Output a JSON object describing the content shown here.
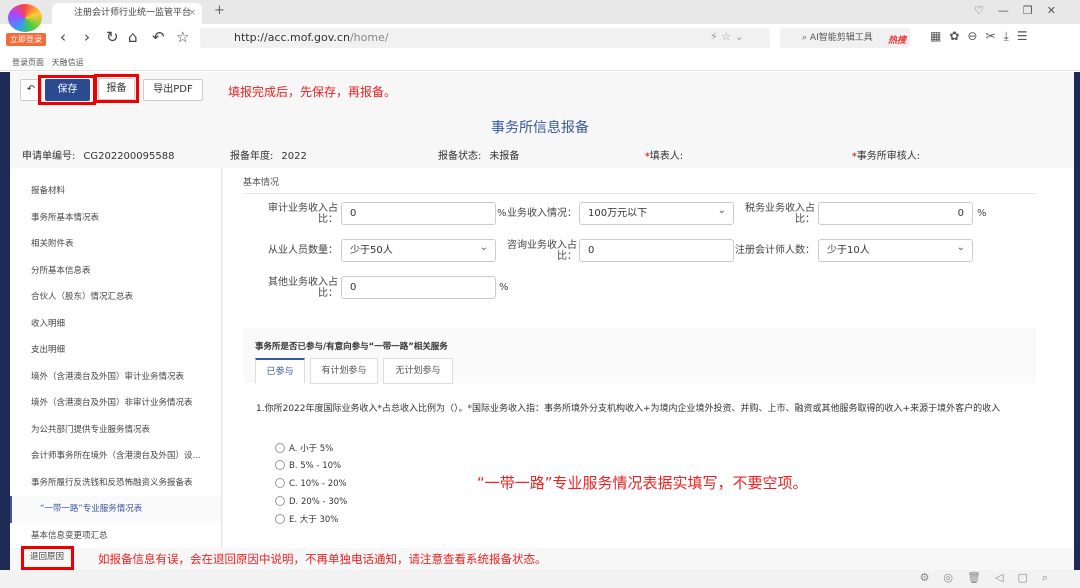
{
  "browser": {
    "tab_title": "注册会计师行业统一监管平台",
    "login_badge": "立即登录",
    "url_domain": "http://acc.mof.gov.cn",
    "url_path": "/home/",
    "search_placeholder": "AI智能剪辑工具",
    "hot_label": "热搜",
    "bookmarks": [
      "登录页面",
      "天融信运"
    ]
  },
  "toolbar": {
    "save": "保存",
    "file": "报备",
    "export": "导出PDF",
    "note": "填报完成后，先保存，再报备。"
  },
  "page": {
    "title": "事务所信息报备",
    "info": [
      {
        "label": "申请单编号:",
        "value": "CG202200095588"
      },
      {
        "label": "报备年度:",
        "value": "2022"
      },
      {
        "label": "报备状态:",
        "value": "未报备"
      },
      {
        "label": "填表人:",
        "value": ""
      },
      {
        "label": "事务所审核人:",
        "value": ""
      }
    ]
  },
  "sidebar": {
    "items": [
      "报备材料",
      "事务所基本情况表",
      "相关附件表",
      "分所基本信息表",
      "合伙人（股东）情况汇总表",
      "收入明细",
      "支出明细",
      "境外（含港澳台及外国）审计业务情况表",
      "境外（含港澳台及外国）非审计业务情况表",
      "为公共部门提供专业服务情况表",
      "会计师事务所在境外（含港澳台及外国）设...",
      "事务所履行反洗钱和反恐怖融资义务报备表",
      "“一带一路”专业服务情况表",
      "基本信息变更项汇总",
      "退回原因"
    ]
  },
  "basic": {
    "section": "基本情况",
    "audit_label": "审计业务收入占比：",
    "audit_value": "0",
    "pct": "%",
    "biz_label": "业务收入情况：",
    "biz_value": "100万元以下",
    "tax_label": "税务业务收入占比：",
    "tax_value": "0",
    "staff_label": "从业人员数量：",
    "staff_value": "少于50人",
    "consult_label": "咨询业务收入占比：",
    "consult_value": "0",
    "cpa_label": "注册会计师人数：",
    "cpa_value": "少于10人",
    "other_label": "其他业务收入占比：",
    "other_value": "0"
  },
  "belt": {
    "heading": "事务所是否已参与/有意向参与“一带一路”相关服务",
    "tabs": [
      "已参与",
      "有计划参与",
      "无计划参与"
    ],
    "question": "1.你所2022年度国际业务收入*占总收入比例为（）。*国际业务收入指：事务所境外分支机构收入+为境内企业境外投资、并购、上市、融资或其他服务取得的收入+来源于境外客户的收入",
    "options": [
      "A. 小于 5%",
      "B. 5% - 10%",
      "C. 10% - 20%",
      "D. 20% - 30%",
      "E. 大于 30%"
    ]
  },
  "annotations": {
    "belt_note": "“一带一路”专业服务情况表据实填写，不要空项。",
    "return_note": "如报备信息有误，会在退回原因中说明，不再单独电话通知，请注意查看系统报备状态。"
  },
  "colors": {
    "accent": "#2b4a8f",
    "annotation": "#e22222",
    "frame": "#1c2a55"
  }
}
